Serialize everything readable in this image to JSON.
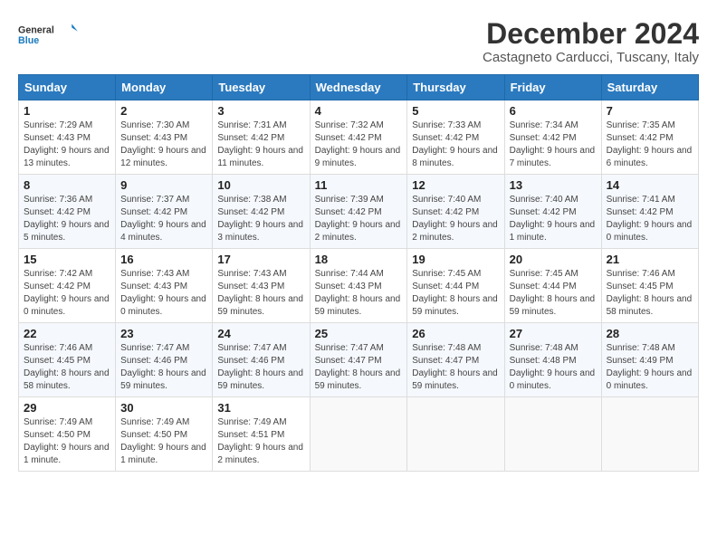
{
  "header": {
    "logo_line1": "General",
    "logo_line2": "Blue",
    "month_title": "December 2024",
    "location": "Castagneto Carducci, Tuscany, Italy"
  },
  "weekdays": [
    "Sunday",
    "Monday",
    "Tuesday",
    "Wednesday",
    "Thursday",
    "Friday",
    "Saturday"
  ],
  "weeks": [
    [
      {
        "day": "1",
        "sunrise": "7:29 AM",
        "sunset": "4:43 PM",
        "daylight": "9 hours and 13 minutes."
      },
      {
        "day": "2",
        "sunrise": "7:30 AM",
        "sunset": "4:43 PM",
        "daylight": "9 hours and 12 minutes."
      },
      {
        "day": "3",
        "sunrise": "7:31 AM",
        "sunset": "4:42 PM",
        "daylight": "9 hours and 11 minutes."
      },
      {
        "day": "4",
        "sunrise": "7:32 AM",
        "sunset": "4:42 PM",
        "daylight": "9 hours and 9 minutes."
      },
      {
        "day": "5",
        "sunrise": "7:33 AM",
        "sunset": "4:42 PM",
        "daylight": "9 hours and 8 minutes."
      },
      {
        "day": "6",
        "sunrise": "7:34 AM",
        "sunset": "4:42 PM",
        "daylight": "9 hours and 7 minutes."
      },
      {
        "day": "7",
        "sunrise": "7:35 AM",
        "sunset": "4:42 PM",
        "daylight": "9 hours and 6 minutes."
      }
    ],
    [
      {
        "day": "8",
        "sunrise": "7:36 AM",
        "sunset": "4:42 PM",
        "daylight": "9 hours and 5 minutes."
      },
      {
        "day": "9",
        "sunrise": "7:37 AM",
        "sunset": "4:42 PM",
        "daylight": "9 hours and 4 minutes."
      },
      {
        "day": "10",
        "sunrise": "7:38 AM",
        "sunset": "4:42 PM",
        "daylight": "9 hours and 3 minutes."
      },
      {
        "day": "11",
        "sunrise": "7:39 AM",
        "sunset": "4:42 PM",
        "daylight": "9 hours and 2 minutes."
      },
      {
        "day": "12",
        "sunrise": "7:40 AM",
        "sunset": "4:42 PM",
        "daylight": "9 hours and 2 minutes."
      },
      {
        "day": "13",
        "sunrise": "7:40 AM",
        "sunset": "4:42 PM",
        "daylight": "9 hours and 1 minute."
      },
      {
        "day": "14",
        "sunrise": "7:41 AM",
        "sunset": "4:42 PM",
        "daylight": "9 hours and 0 minutes."
      }
    ],
    [
      {
        "day": "15",
        "sunrise": "7:42 AM",
        "sunset": "4:42 PM",
        "daylight": "9 hours and 0 minutes."
      },
      {
        "day": "16",
        "sunrise": "7:43 AM",
        "sunset": "4:43 PM",
        "daylight": "9 hours and 0 minutes."
      },
      {
        "day": "17",
        "sunrise": "7:43 AM",
        "sunset": "4:43 PM",
        "daylight": "8 hours and 59 minutes."
      },
      {
        "day": "18",
        "sunrise": "7:44 AM",
        "sunset": "4:43 PM",
        "daylight": "8 hours and 59 minutes."
      },
      {
        "day": "19",
        "sunrise": "7:45 AM",
        "sunset": "4:44 PM",
        "daylight": "8 hours and 59 minutes."
      },
      {
        "day": "20",
        "sunrise": "7:45 AM",
        "sunset": "4:44 PM",
        "daylight": "8 hours and 59 minutes."
      },
      {
        "day": "21",
        "sunrise": "7:46 AM",
        "sunset": "4:45 PM",
        "daylight": "8 hours and 58 minutes."
      }
    ],
    [
      {
        "day": "22",
        "sunrise": "7:46 AM",
        "sunset": "4:45 PM",
        "daylight": "8 hours and 58 minutes."
      },
      {
        "day": "23",
        "sunrise": "7:47 AM",
        "sunset": "4:46 PM",
        "daylight": "8 hours and 59 minutes."
      },
      {
        "day": "24",
        "sunrise": "7:47 AM",
        "sunset": "4:46 PM",
        "daylight": "8 hours and 59 minutes."
      },
      {
        "day": "25",
        "sunrise": "7:47 AM",
        "sunset": "4:47 PM",
        "daylight": "8 hours and 59 minutes."
      },
      {
        "day": "26",
        "sunrise": "7:48 AM",
        "sunset": "4:47 PM",
        "daylight": "8 hours and 59 minutes."
      },
      {
        "day": "27",
        "sunrise": "7:48 AM",
        "sunset": "4:48 PM",
        "daylight": "9 hours and 0 minutes."
      },
      {
        "day": "28",
        "sunrise": "7:48 AM",
        "sunset": "4:49 PM",
        "daylight": "9 hours and 0 minutes."
      }
    ],
    [
      {
        "day": "29",
        "sunrise": "7:49 AM",
        "sunset": "4:50 PM",
        "daylight": "9 hours and 1 minute."
      },
      {
        "day": "30",
        "sunrise": "7:49 AM",
        "sunset": "4:50 PM",
        "daylight": "9 hours and 1 minute."
      },
      {
        "day": "31",
        "sunrise": "7:49 AM",
        "sunset": "4:51 PM",
        "daylight": "9 hours and 2 minutes."
      },
      null,
      null,
      null,
      null
    ]
  ]
}
